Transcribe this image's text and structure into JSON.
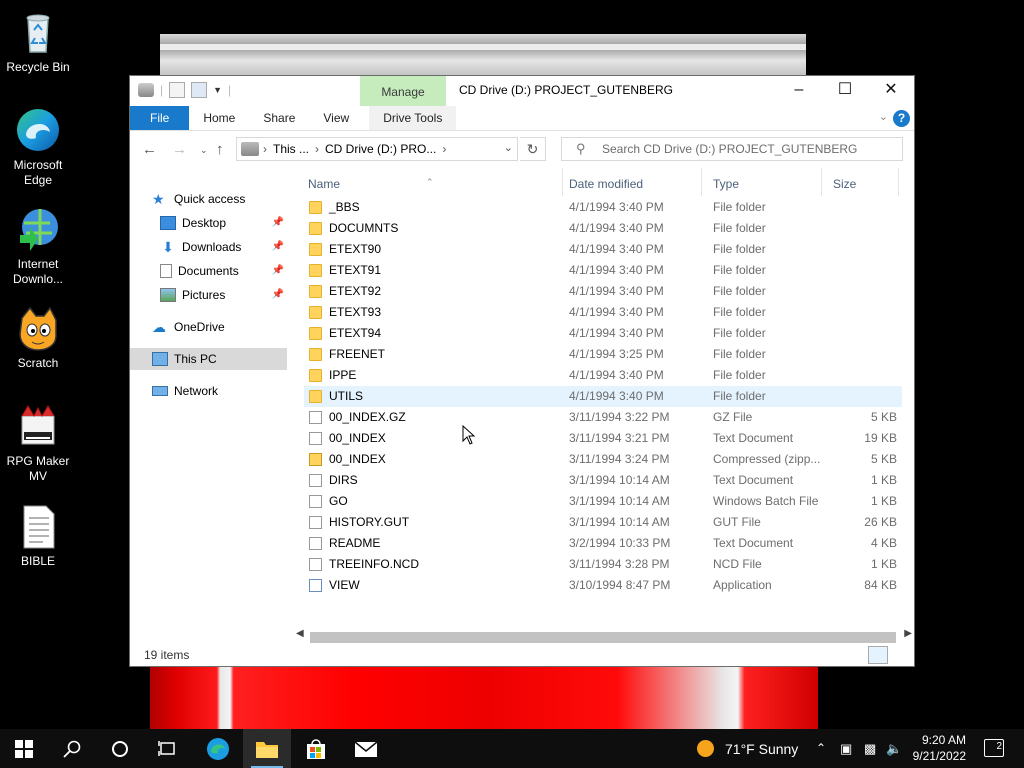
{
  "desktop": {
    "icons": [
      {
        "label": "Recycle Bin",
        "icon": "recycle-bin-icon"
      },
      {
        "label": "Microsoft Edge",
        "icon": "edge-icon"
      },
      {
        "label": "Internet Downlo...",
        "icon": "internet-download-manager-icon"
      },
      {
        "label": "Scratch",
        "icon": "scratch-icon"
      },
      {
        "label": "RPG Maker MV",
        "icon": "rpg-maker-icon"
      },
      {
        "label": "BIBLE",
        "icon": "text-file-icon"
      }
    ]
  },
  "window": {
    "title": "CD Drive (D:) PROJECT_GUTENBERG",
    "manage_tab": "Manage",
    "ribbon_tabs": [
      "File",
      "Home",
      "Share",
      "View",
      "Drive Tools"
    ],
    "help": "?",
    "address": {
      "segments": [
        "This ...",
        "CD Drive (D:) PRO..."
      ]
    },
    "search_placeholder": "Search CD Drive (D:) PROJECT_GUTENBERG",
    "nav": {
      "quick_access": "Quick access",
      "pinned": [
        "Desktop",
        "Downloads",
        "Documents",
        "Pictures"
      ],
      "onedrive": "OneDrive",
      "this_pc": "This PC",
      "network": "Network"
    },
    "columns": [
      "Name",
      "Date modified",
      "Type",
      "Size"
    ],
    "files": [
      {
        "name": "_BBS",
        "date": "4/1/1994 3:40 PM",
        "type": "File folder",
        "size": "",
        "kind": "folder"
      },
      {
        "name": "DOCUMNTS",
        "date": "4/1/1994 3:40 PM",
        "type": "File folder",
        "size": "",
        "kind": "folder"
      },
      {
        "name": "ETEXT90",
        "date": "4/1/1994 3:40 PM",
        "type": "File folder",
        "size": "",
        "kind": "folder"
      },
      {
        "name": "ETEXT91",
        "date": "4/1/1994 3:40 PM",
        "type": "File folder",
        "size": "",
        "kind": "folder"
      },
      {
        "name": "ETEXT92",
        "date": "4/1/1994 3:40 PM",
        "type": "File folder",
        "size": "",
        "kind": "folder"
      },
      {
        "name": "ETEXT93",
        "date": "4/1/1994 3:40 PM",
        "type": "File folder",
        "size": "",
        "kind": "folder"
      },
      {
        "name": "ETEXT94",
        "date": "4/1/1994 3:40 PM",
        "type": "File folder",
        "size": "",
        "kind": "folder"
      },
      {
        "name": "FREENET",
        "date": "4/1/1994 3:25 PM",
        "type": "File folder",
        "size": "",
        "kind": "folder"
      },
      {
        "name": "IPPE",
        "date": "4/1/1994 3:40 PM",
        "type": "File folder",
        "size": "",
        "kind": "folder"
      },
      {
        "name": "UTILS",
        "date": "4/1/1994 3:40 PM",
        "type": "File folder",
        "size": "",
        "kind": "folder"
      },
      {
        "name": "00_INDEX.GZ",
        "date": "3/11/1994 3:22 PM",
        "type": "GZ File",
        "size": "5 KB",
        "kind": "file"
      },
      {
        "name": "00_INDEX",
        "date": "3/11/1994 3:21 PM",
        "type": "Text Document",
        "size": "19 KB",
        "kind": "file"
      },
      {
        "name": "00_INDEX",
        "date": "3/11/1994 3:24 PM",
        "type": "Compressed (zipp...",
        "size": "5 KB",
        "kind": "zip"
      },
      {
        "name": "DIRS",
        "date": "3/1/1994 10:14 AM",
        "type": "Text Document",
        "size": "1 KB",
        "kind": "file"
      },
      {
        "name": "GO",
        "date": "3/1/1994 10:14 AM",
        "type": "Windows Batch File",
        "size": "1 KB",
        "kind": "file"
      },
      {
        "name": "HISTORY.GUT",
        "date": "3/1/1994 10:14 AM",
        "type": "GUT File",
        "size": "26 KB",
        "kind": "file"
      },
      {
        "name": "README",
        "date": "3/2/1994 10:33 PM",
        "type": "Text Document",
        "size": "4 KB",
        "kind": "file"
      },
      {
        "name": "TREEINFO.NCD",
        "date": "3/11/1994 3:28 PM",
        "type": "NCD File",
        "size": "1 KB",
        "kind": "file"
      },
      {
        "name": "VIEW",
        "date": "3/10/1994 8:47 PM",
        "type": "Application",
        "size": "84 KB",
        "kind": "app"
      }
    ],
    "status": "19 items"
  },
  "taskbar": {
    "weather": "71°F  Sunny",
    "time": "9:20 AM",
    "date": "9/21/2022",
    "notifications": "2"
  },
  "colors": {
    "accent": "#1979ca",
    "manage_tab": "#c6ecbd",
    "folder": "#ffd35c"
  }
}
